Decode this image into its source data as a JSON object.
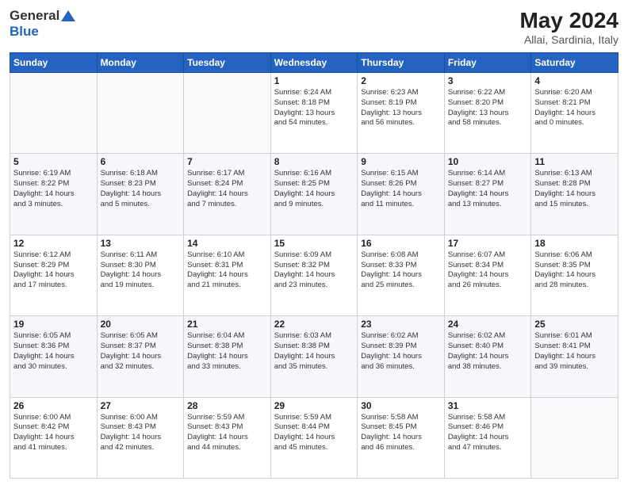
{
  "header": {
    "logo_general": "General",
    "logo_blue": "Blue",
    "title": "May 2024",
    "subtitle": "Allai, Sardinia, Italy"
  },
  "calendar": {
    "days_of_week": [
      "Sunday",
      "Monday",
      "Tuesday",
      "Wednesday",
      "Thursday",
      "Friday",
      "Saturday"
    ],
    "weeks": [
      [
        {
          "num": "",
          "info": ""
        },
        {
          "num": "",
          "info": ""
        },
        {
          "num": "",
          "info": ""
        },
        {
          "num": "1",
          "info": "Sunrise: 6:24 AM\nSunset: 8:18 PM\nDaylight: 13 hours\nand 54 minutes."
        },
        {
          "num": "2",
          "info": "Sunrise: 6:23 AM\nSunset: 8:19 PM\nDaylight: 13 hours\nand 56 minutes."
        },
        {
          "num": "3",
          "info": "Sunrise: 6:22 AM\nSunset: 8:20 PM\nDaylight: 13 hours\nand 58 minutes."
        },
        {
          "num": "4",
          "info": "Sunrise: 6:20 AM\nSunset: 8:21 PM\nDaylight: 14 hours\nand 0 minutes."
        }
      ],
      [
        {
          "num": "5",
          "info": "Sunrise: 6:19 AM\nSunset: 8:22 PM\nDaylight: 14 hours\nand 3 minutes."
        },
        {
          "num": "6",
          "info": "Sunrise: 6:18 AM\nSunset: 8:23 PM\nDaylight: 14 hours\nand 5 minutes."
        },
        {
          "num": "7",
          "info": "Sunrise: 6:17 AM\nSunset: 8:24 PM\nDaylight: 14 hours\nand 7 minutes."
        },
        {
          "num": "8",
          "info": "Sunrise: 6:16 AM\nSunset: 8:25 PM\nDaylight: 14 hours\nand 9 minutes."
        },
        {
          "num": "9",
          "info": "Sunrise: 6:15 AM\nSunset: 8:26 PM\nDaylight: 14 hours\nand 11 minutes."
        },
        {
          "num": "10",
          "info": "Sunrise: 6:14 AM\nSunset: 8:27 PM\nDaylight: 14 hours\nand 13 minutes."
        },
        {
          "num": "11",
          "info": "Sunrise: 6:13 AM\nSunset: 8:28 PM\nDaylight: 14 hours\nand 15 minutes."
        }
      ],
      [
        {
          "num": "12",
          "info": "Sunrise: 6:12 AM\nSunset: 8:29 PM\nDaylight: 14 hours\nand 17 minutes."
        },
        {
          "num": "13",
          "info": "Sunrise: 6:11 AM\nSunset: 8:30 PM\nDaylight: 14 hours\nand 19 minutes."
        },
        {
          "num": "14",
          "info": "Sunrise: 6:10 AM\nSunset: 8:31 PM\nDaylight: 14 hours\nand 21 minutes."
        },
        {
          "num": "15",
          "info": "Sunrise: 6:09 AM\nSunset: 8:32 PM\nDaylight: 14 hours\nand 23 minutes."
        },
        {
          "num": "16",
          "info": "Sunrise: 6:08 AM\nSunset: 8:33 PM\nDaylight: 14 hours\nand 25 minutes."
        },
        {
          "num": "17",
          "info": "Sunrise: 6:07 AM\nSunset: 8:34 PM\nDaylight: 14 hours\nand 26 minutes."
        },
        {
          "num": "18",
          "info": "Sunrise: 6:06 AM\nSunset: 8:35 PM\nDaylight: 14 hours\nand 28 minutes."
        }
      ],
      [
        {
          "num": "19",
          "info": "Sunrise: 6:05 AM\nSunset: 8:36 PM\nDaylight: 14 hours\nand 30 minutes."
        },
        {
          "num": "20",
          "info": "Sunrise: 6:05 AM\nSunset: 8:37 PM\nDaylight: 14 hours\nand 32 minutes."
        },
        {
          "num": "21",
          "info": "Sunrise: 6:04 AM\nSunset: 8:38 PM\nDaylight: 14 hours\nand 33 minutes."
        },
        {
          "num": "22",
          "info": "Sunrise: 6:03 AM\nSunset: 8:38 PM\nDaylight: 14 hours\nand 35 minutes."
        },
        {
          "num": "23",
          "info": "Sunrise: 6:02 AM\nSunset: 8:39 PM\nDaylight: 14 hours\nand 36 minutes."
        },
        {
          "num": "24",
          "info": "Sunrise: 6:02 AM\nSunset: 8:40 PM\nDaylight: 14 hours\nand 38 minutes."
        },
        {
          "num": "25",
          "info": "Sunrise: 6:01 AM\nSunset: 8:41 PM\nDaylight: 14 hours\nand 39 minutes."
        }
      ],
      [
        {
          "num": "26",
          "info": "Sunrise: 6:00 AM\nSunset: 8:42 PM\nDaylight: 14 hours\nand 41 minutes."
        },
        {
          "num": "27",
          "info": "Sunrise: 6:00 AM\nSunset: 8:43 PM\nDaylight: 14 hours\nand 42 minutes."
        },
        {
          "num": "28",
          "info": "Sunrise: 5:59 AM\nSunset: 8:43 PM\nDaylight: 14 hours\nand 44 minutes."
        },
        {
          "num": "29",
          "info": "Sunrise: 5:59 AM\nSunset: 8:44 PM\nDaylight: 14 hours\nand 45 minutes."
        },
        {
          "num": "30",
          "info": "Sunrise: 5:58 AM\nSunset: 8:45 PM\nDaylight: 14 hours\nand 46 minutes."
        },
        {
          "num": "31",
          "info": "Sunrise: 5:58 AM\nSunset: 8:46 PM\nDaylight: 14 hours\nand 47 minutes."
        },
        {
          "num": "",
          "info": ""
        }
      ]
    ]
  }
}
